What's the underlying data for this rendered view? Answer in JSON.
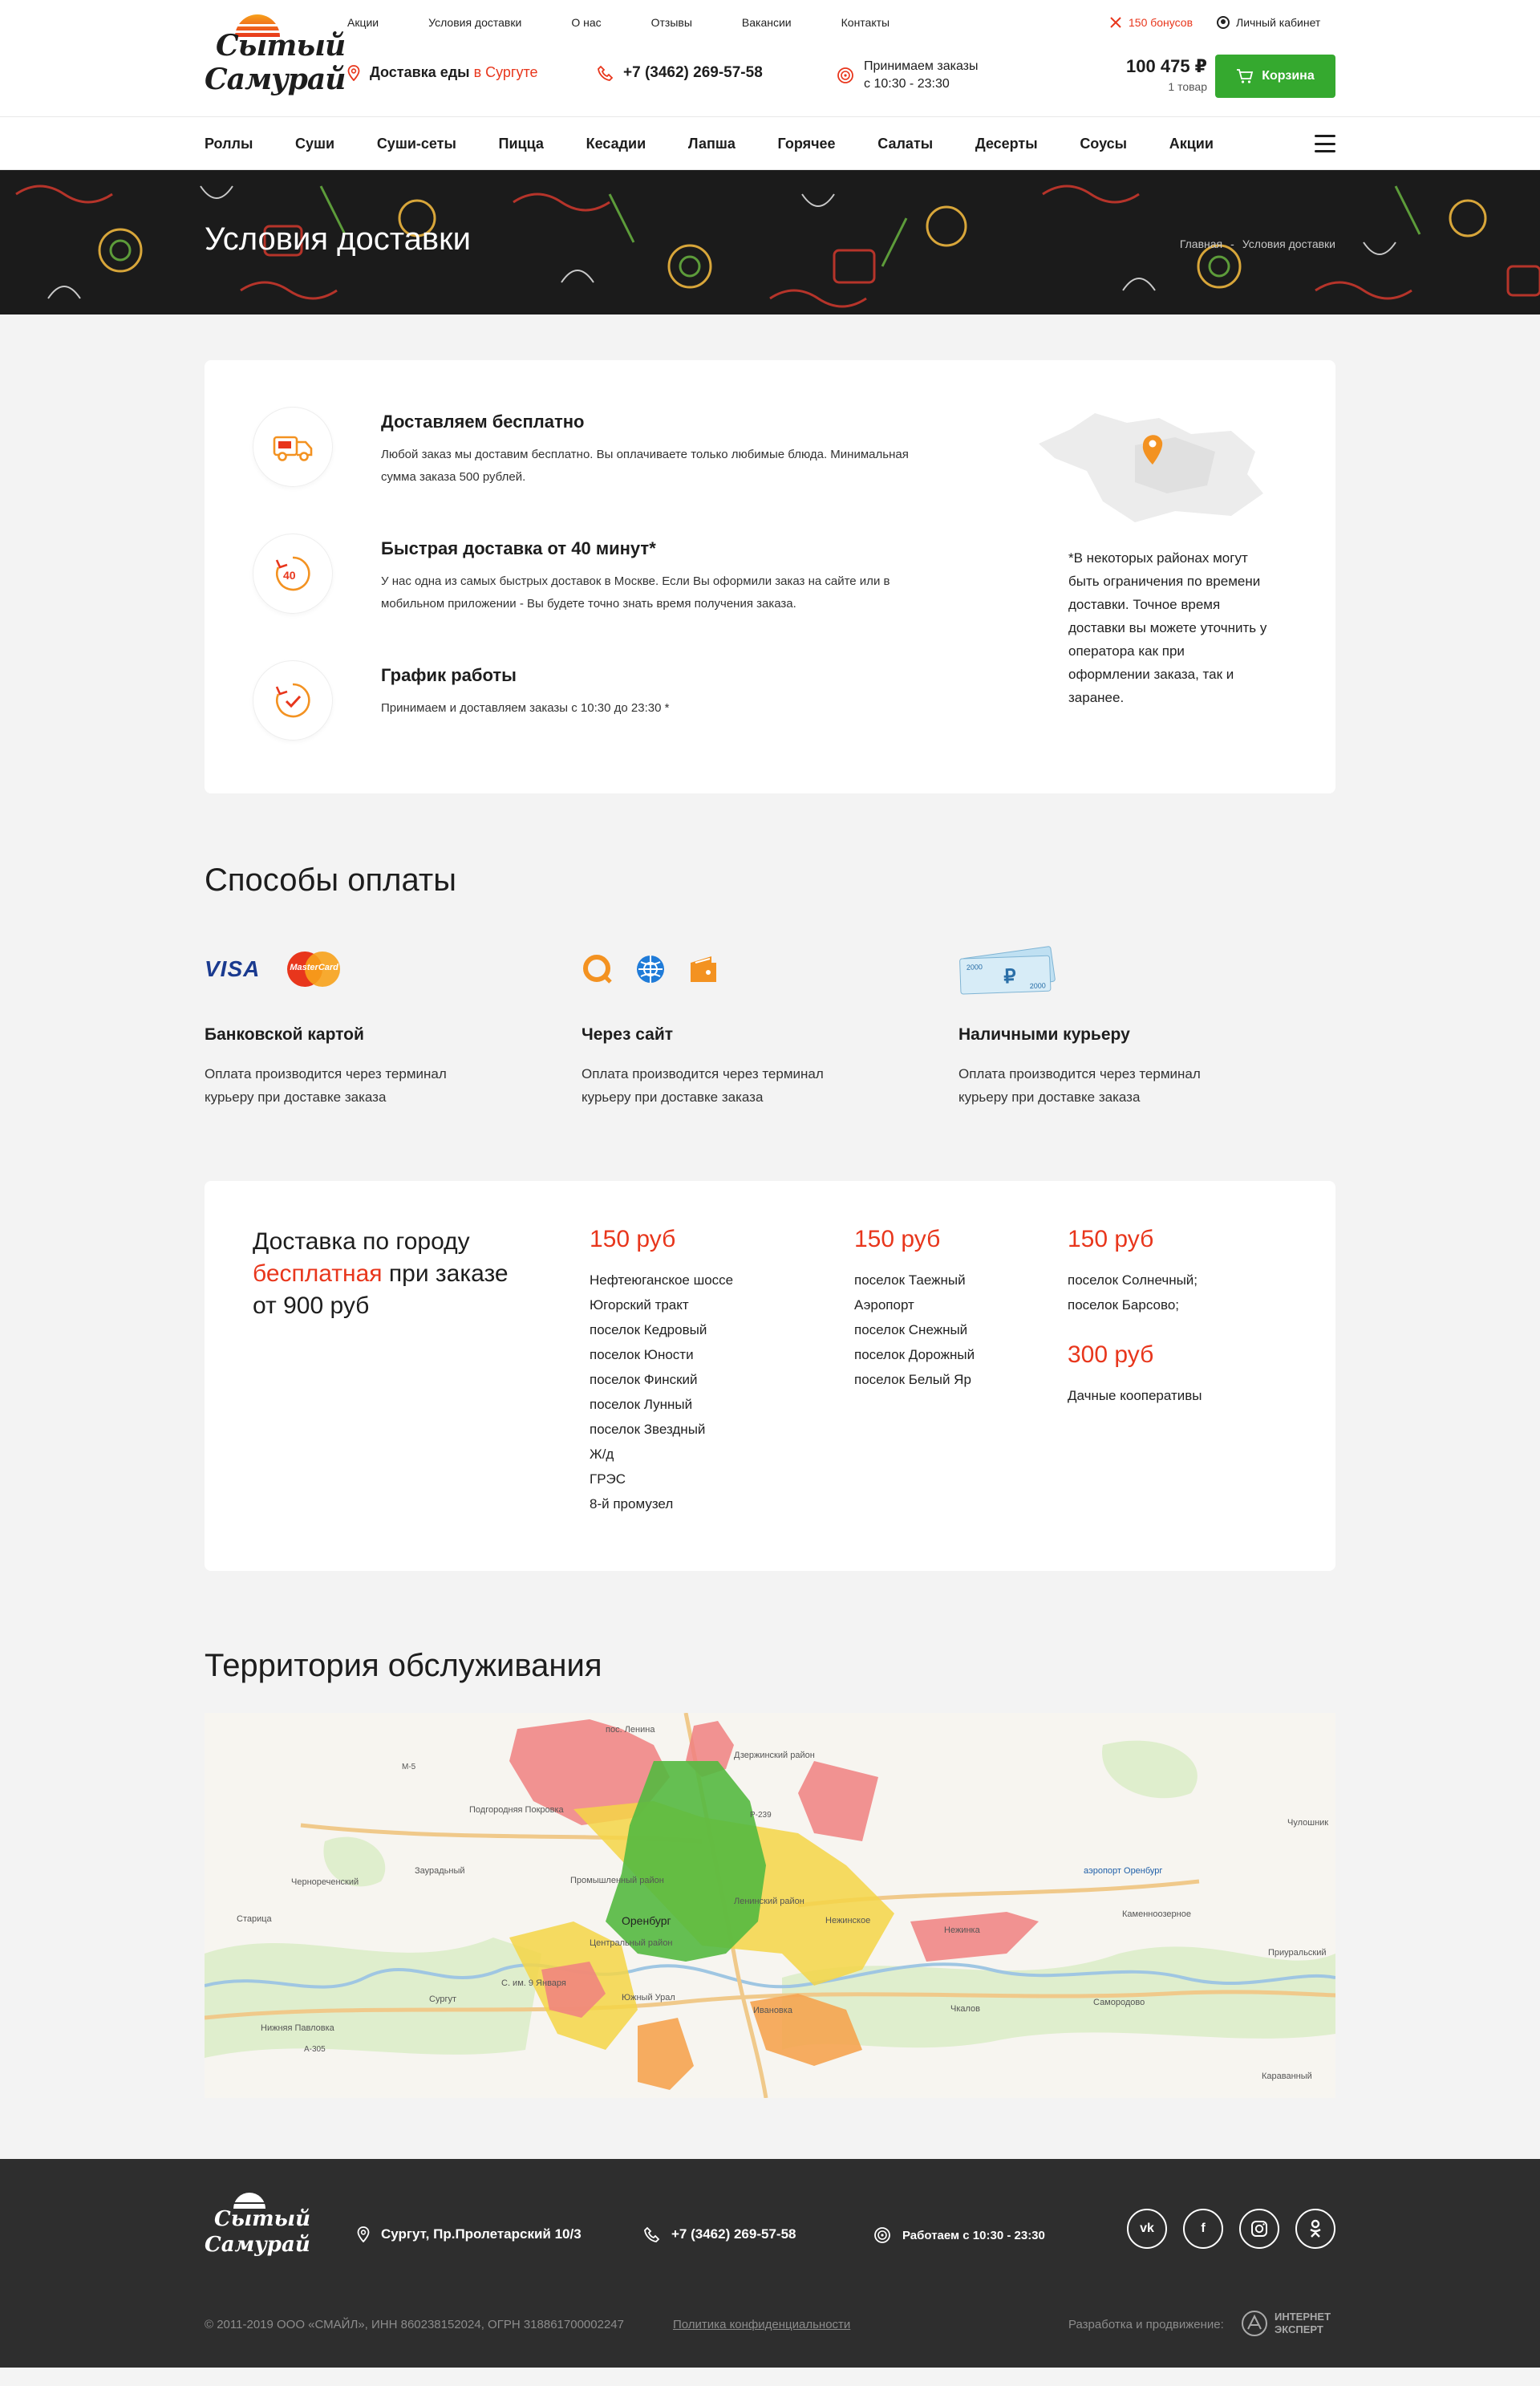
{
  "brand": {
    "name_line1": "Сытый",
    "name_line2": "Самурай"
  },
  "top_links": [
    "Акции",
    "Условия доставки",
    "О нас",
    "Отзывы",
    "Вакансии",
    "Контакты"
  ],
  "header": {
    "bonus": "150 бонусов",
    "cabinet": "Личный кабинет",
    "delivery_label": "Доставка еды",
    "delivery_city": "в Сургуте",
    "phone": "+7 (3462) 269-57-58",
    "hours_line1": "Принимаем заказы",
    "hours_line2": "с 10:30 - 23:30",
    "cart_sum": "100 475 ₽",
    "cart_qty": "1 товар",
    "cart_button": "Корзина"
  },
  "nav": [
    "Роллы",
    "Суши",
    "Суши-сеты",
    "Пицца",
    "Кесадии",
    "Лапша",
    "Горячее",
    "Салаты",
    "Десерты",
    "Соусы",
    "Акции"
  ],
  "hero": {
    "title": "Условия доставки",
    "breadcrumb_home": "Главная",
    "breadcrumb_sep": "-",
    "breadcrumb_current": "Условия доставки"
  },
  "features": [
    {
      "icon": "delivery-truck-icon",
      "title": "Доставляем бесплатно",
      "text": "Любой заказ мы доставим бесплатно. Вы оплачиваете только любимые блюда. Минимальная сумма заказа 500 рублей."
    },
    {
      "icon": "timer-40-icon",
      "title": "Быстрая доставка от 40 минут*",
      "text": "У нас одна из самых быстрых доставок в Москве. Если Вы оформили заказ на сайте или в мобильном приложении - Вы будете точно знать время получения заказа."
    },
    {
      "icon": "clock-check-icon",
      "title": "График работы",
      "text": "Принимаем и доставляем заказы с 10:30 до 23:30 *"
    }
  ],
  "note": "*В некоторых районах могут быть ограничения по времени доставки. Точное время доставки вы можете уточнить у оператора как при оформлении заказа, так и заранее.",
  "payment": {
    "title": "Способы оплаты",
    "methods": [
      {
        "title": "Банковской картой",
        "text": "Оплата производится через терминал курьеру при доставке заказа",
        "logos": [
          "VISA",
          "MasterCard"
        ]
      },
      {
        "title": "Через сайт",
        "text": "Оплата производится через терминал курьеру при доставке заказа",
        "logos": [
          "qiwi-icon",
          "webmoney-icon",
          "yandex-money-icon"
        ]
      },
      {
        "title": "Наличными курьеру",
        "text": "Оплата производится через терминал курьеру при доставке заказа",
        "logos": [
          "2000",
          "2000"
        ]
      }
    ]
  },
  "prices": {
    "head_line1": "Доставка по городу",
    "head_red": "бесплатная",
    "head_line2": "при заказе",
    "head_line3": "от 900 руб",
    "columns": [
      {
        "price": "150 руб",
        "places": [
          "Нефтеюганское шоссе",
          "Югорский тракт",
          "поселок Кедровый",
          "поселок Юности",
          "поселок Финский",
          "поселок Лунный",
          "поселок Звездный",
          "Ж/д",
          "ГРЭС",
          "8-й промузел"
        ]
      },
      {
        "price": "150 руб",
        "places": [
          "поселок Таежный",
          "Аэропорт",
          "поселок Снежный",
          "поселок Дорожный",
          "поселок Белый Яр"
        ]
      },
      {
        "price": "150 руб",
        "places": [
          "поселок Солнечный;",
          "поселок Барсово;"
        ]
      },
      {
        "price": "300 руб",
        "places": [
          "Дачные кооперативы"
        ]
      }
    ]
  },
  "territory": {
    "title": "Территория обслуживания",
    "map_labels": [
      "пос. Ленина",
      "Дзержинский район",
      "Подгородняя Покровка",
      "Заурадьный",
      "Чернореченский",
      "Оренбург",
      "Центральный район",
      "Промышленный район",
      "Ленинский район",
      "Нежинка",
      "Нежинское",
      "аэропорт Оренбург",
      "Каменноозерное",
      "Чулошник",
      "Приуральский",
      "Самородово",
      "Чкалов",
      "Караванный",
      "Нижняя Павловка",
      "Сургут",
      "Южный Урал",
      "Ивановка",
      "Старица",
      "С. им. 9 Января",
      "М-5",
      "Р-239",
      "А-305"
    ]
  },
  "footer": {
    "address": "Сургут, Пр.Пролетарский 10/3",
    "phone": "+7 (3462) 269-57-58",
    "hours": "Работаем с 10:30 - 23:30",
    "socials": [
      "vk",
      "f",
      "ig",
      "ok"
    ],
    "copyright": "© 2011-2019  ООО «СМАЙЛ», ИНН 860238152024, ОГРН 318861700002247",
    "policy": "Политика конфиденциальности",
    "dev": "Разработка и продвижение:",
    "dev_logo_line1": "ИНТЕРНЕТ",
    "dev_logo_line2": "ЭКСПЕРТ"
  },
  "colors": {
    "accent": "#e8361c",
    "green": "#35a92f",
    "dark": "#2e2e2e"
  }
}
